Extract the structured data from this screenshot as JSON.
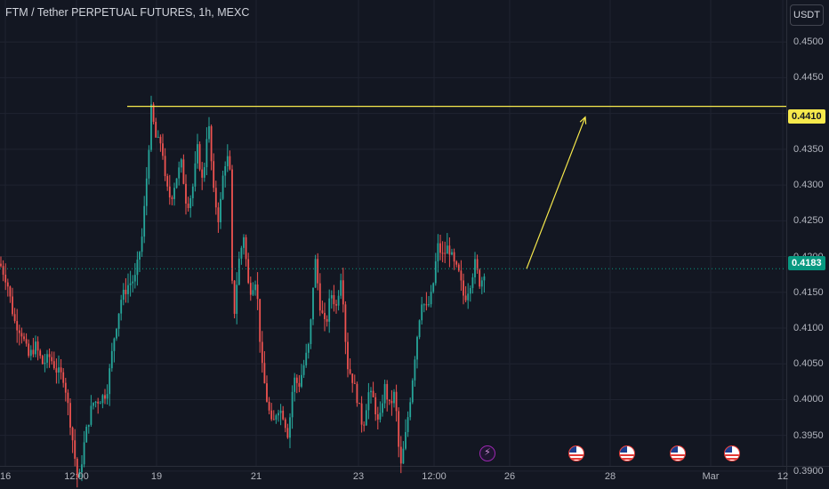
{
  "header": {
    "title": "FTM / Tether PERPETUAL FUTURES, 1h, MEXC",
    "currency_button": "USDT"
  },
  "price_tags": {
    "level": "0.4410",
    "last": "0.4183"
  },
  "colors": {
    "background": "#131722",
    "up": "#26a69a",
    "down": "#ef5350",
    "level_line": "#f7e94c",
    "last_price": "#089981"
  },
  "event_icons": [
    "flash-icon",
    "us-flag-icon",
    "us-flag-icon",
    "us-flag-icon",
    "us-flag-icon"
  ],
  "chart_data": {
    "type": "candlestick",
    "exchange": "MEXC",
    "symbol": "FTM / Tether PERPETUAL FUTURES",
    "interval": "1h",
    "ylim": [
      0.3875,
      0.4545
    ],
    "y_ticks": [
      "0.4500",
      "0.4450",
      "0.4400",
      "0.4350",
      "0.4300",
      "0.4250",
      "0.4200",
      "0.4150",
      "0.4100",
      "0.4050",
      "0.4000",
      "0.3950",
      "0.3900"
    ],
    "x_ticks": [
      "16",
      "12:00",
      "19",
      "21",
      "23",
      "12:00",
      "26",
      "28",
      "Mar",
      "12"
    ],
    "grid": true,
    "horizontal_level": 0.441,
    "last_price": 0.4183,
    "anchors": [
      [
        0,
        0.419
      ],
      [
        8,
        0.4165
      ],
      [
        16,
        0.411
      ],
      [
        24,
        0.4095
      ],
      [
        32,
        0.406
      ],
      [
        40,
        0.4075
      ],
      [
        48,
        0.405
      ],
      [
        56,
        0.406
      ],
      [
        64,
        0.404
      ],
      [
        72,
        0.403
      ],
      [
        80,
        0.396
      ],
      [
        88,
        0.388
      ],
      [
        96,
        0.395
      ],
      [
        104,
        0.3995
      ],
      [
        112,
        0.4
      ],
      [
        120,
        0.401
      ],
      [
        128,
        0.4085
      ],
      [
        136,
        0.414
      ],
      [
        144,
        0.416
      ],
      [
        152,
        0.417
      ],
      [
        160,
        0.423
      ],
      [
        166,
        0.433
      ],
      [
        170,
        0.4405
      ],
      [
        176,
        0.436
      ],
      [
        182,
        0.436
      ],
      [
        186,
        0.43
      ],
      [
        192,
        0.428
      ],
      [
        198,
        0.431
      ],
      [
        204,
        0.433
      ],
      [
        210,
        0.427
      ],
      [
        216,
        0.429
      ],
      [
        222,
        0.435
      ],
      [
        228,
        0.43
      ],
      [
        234,
        0.4395
      ],
      [
        240,
        0.429
      ],
      [
        246,
        0.425
      ],
      [
        252,
        0.433
      ],
      [
        258,
        0.434
      ],
      [
        262,
        0.41
      ],
      [
        268,
        0.419
      ],
      [
        274,
        0.423
      ],
      [
        280,
        0.415
      ],
      [
        288,
        0.417
      ],
      [
        294,
        0.405
      ],
      [
        300,
        0.4
      ],
      [
        306,
        0.396
      ],
      [
        312,
        0.399
      ],
      [
        318,
        0.398
      ],
      [
        324,
        0.395
      ],
      [
        330,
        0.403
      ],
      [
        336,
        0.402
      ],
      [
        342,
        0.405
      ],
      [
        348,
        0.408
      ],
      [
        354,
        0.42
      ],
      [
        360,
        0.413
      ],
      [
        366,
        0.41
      ],
      [
        372,
        0.415
      ],
      [
        378,
        0.413
      ],
      [
        384,
        0.418
      ],
      [
        390,
        0.405
      ],
      [
        396,
        0.403
      ],
      [
        402,
        0.4
      ],
      [
        408,
        0.396
      ],
      [
        414,
        0.401
      ],
      [
        420,
        0.4
      ],
      [
        426,
        0.396
      ],
      [
        432,
        0.402
      ],
      [
        438,
        0.399
      ],
      [
        444,
        0.401
      ],
      [
        450,
        0.39
      ],
      [
        456,
        0.395
      ],
      [
        462,
        0.401
      ],
      [
        468,
        0.408
      ],
      [
        474,
        0.414
      ],
      [
        480,
        0.4125
      ],
      [
        486,
        0.415
      ],
      [
        492,
        0.4215
      ],
      [
        498,
        0.42
      ],
      [
        504,
        0.4215
      ],
      [
        510,
        0.419
      ],
      [
        516,
        0.4175
      ],
      [
        522,
        0.414
      ],
      [
        528,
        0.416
      ],
      [
        534,
        0.419
      ],
      [
        540,
        0.416
      ],
      [
        545,
        0.4183
      ]
    ],
    "projection_arrow": {
      "from": [
        592,
        0.4183
      ],
      "to": [
        658,
        0.4395
      ]
    }
  }
}
